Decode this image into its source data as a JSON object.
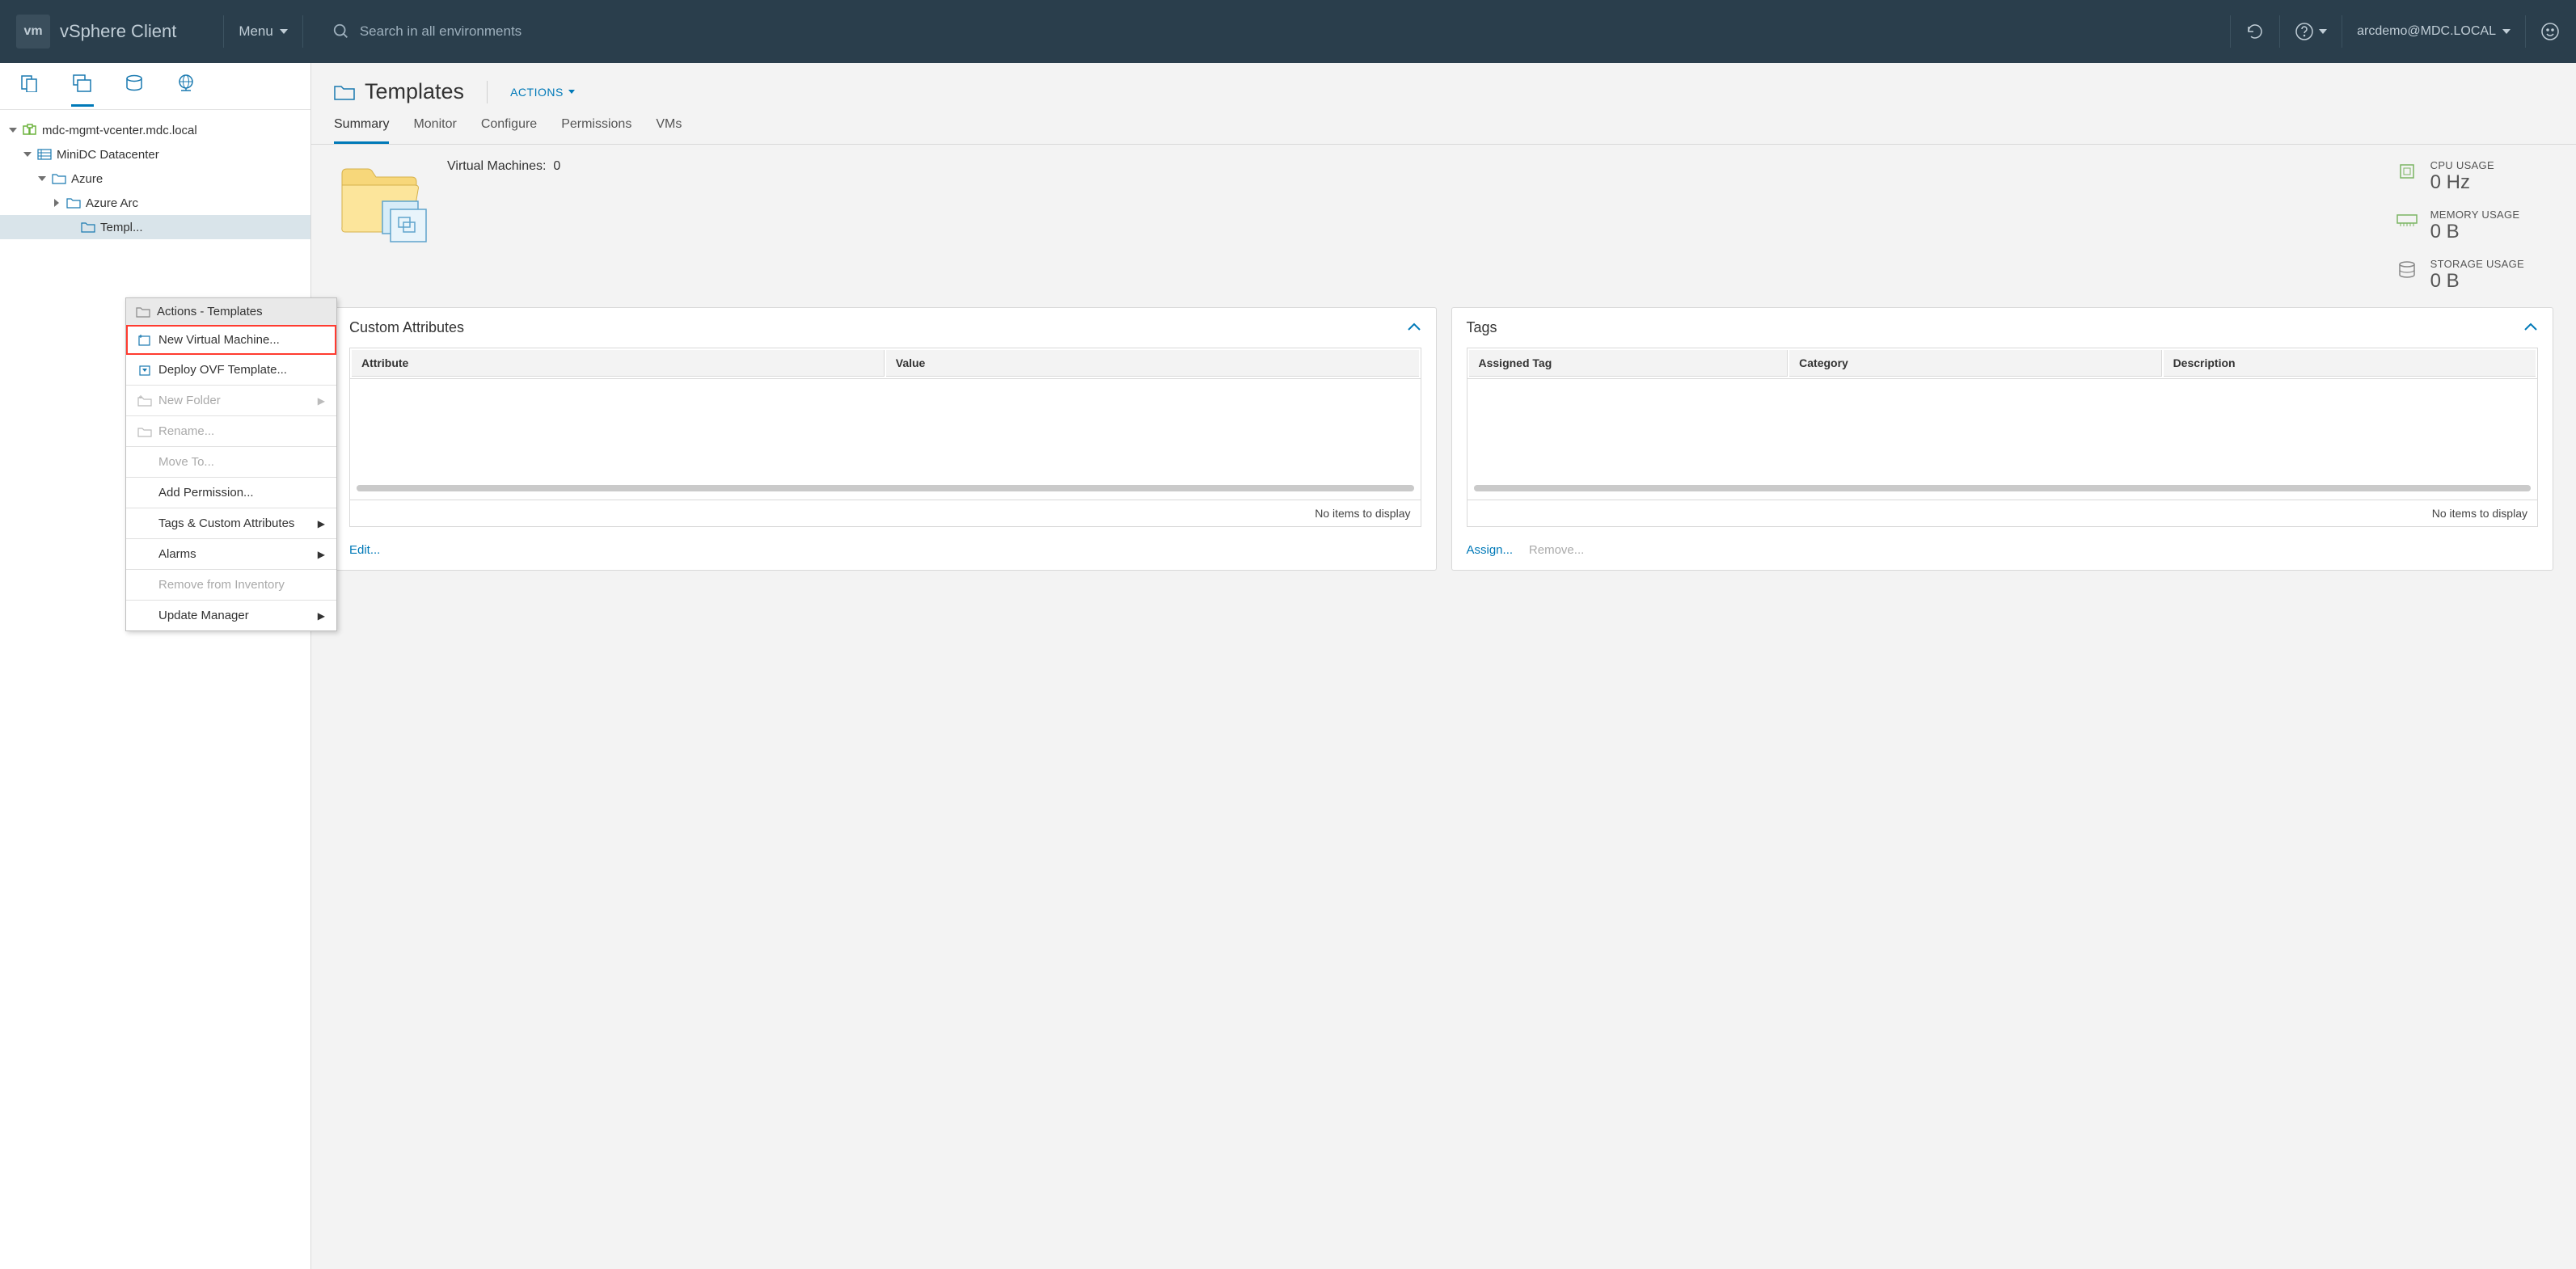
{
  "header": {
    "client": "vSphere Client",
    "menu": "Menu",
    "search_placeholder": "Search in all environments",
    "user": "arcdemo@MDC.LOCAL"
  },
  "tree": {
    "root": "mdc-mgmt-vcenter.mdc.local",
    "datacenter": "MiniDC Datacenter",
    "folder1": "Azure",
    "folder2": "Azure Arc",
    "selected": "Templ..."
  },
  "contextMenu": {
    "title": "Actions - Templates",
    "items": {
      "newVM": "New Virtual Machine...",
      "deployOVF": "Deploy OVF Template...",
      "newFolder": "New Folder",
      "rename": "Rename...",
      "moveTo": "Move To...",
      "addPermission": "Add Permission...",
      "tagsAttrs": "Tags & Custom Attributes",
      "alarms": "Alarms",
      "removeInv": "Remove from Inventory",
      "updateMgr": "Update Manager"
    }
  },
  "page": {
    "title": "Templates",
    "actions": "ACTIONS"
  },
  "tabs": {
    "summary": "Summary",
    "monitor": "Monitor",
    "configure": "Configure",
    "permissions": "Permissions",
    "vms": "VMs"
  },
  "summary": {
    "vmCountLabel": "Virtual Machines:",
    "vmCount": "0"
  },
  "usage": {
    "cpu_label": "CPU USAGE",
    "cpu_value": "0 Hz",
    "mem_label": "MEMORY USAGE",
    "mem_value": "0 B",
    "storage_label": "STORAGE USAGE",
    "storage_value": "0 B"
  },
  "cards": {
    "customAttributes": {
      "title": "Custom Attributes",
      "col1": "Attribute",
      "col2": "Value",
      "empty": "No items to display",
      "edit": "Edit..."
    },
    "tags": {
      "title": "Tags",
      "col1": "Assigned Tag",
      "col2": "Category",
      "col3": "Description",
      "empty": "No items to display",
      "assign": "Assign...",
      "remove": "Remove..."
    }
  }
}
